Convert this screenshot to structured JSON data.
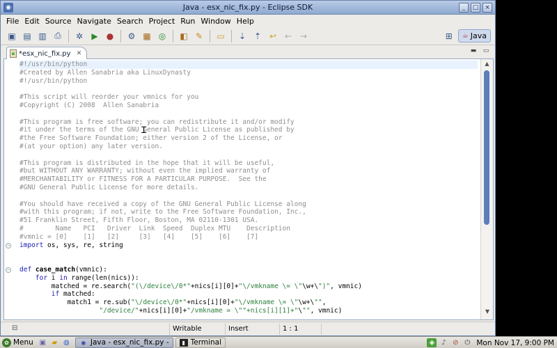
{
  "window": {
    "title": "Java - esx_nic_fix.py - Eclipse SDK"
  },
  "menubar": [
    "File",
    "Edit",
    "Source",
    "Navigate",
    "Search",
    "Project",
    "Run",
    "Window",
    "Help"
  ],
  "toolbar": {
    "icons": [
      "new-icon",
      "save-icon",
      "save-all-icon",
      "print-icon",
      "debug-icon",
      "run-icon",
      "external-tools-icon",
      "new-java-project-icon",
      "new-package-icon",
      "new-class-icon",
      "open-type-icon",
      "search-icon",
      "open-folder-icon",
      "annotation-next-icon",
      "annotation-prev-icon",
      "last-edit-icon",
      "back-icon",
      "forward-icon"
    ]
  },
  "perspective": {
    "label": "Java"
  },
  "editor": {
    "tab_label": "*esx_nic_fix.py",
    "lines": [
      {
        "t": "#!/usr/bin/python",
        "c": "cm",
        "current": true
      },
      {
        "t": "#Created by Allen Sanabria aka LinuxDynasty",
        "c": "cm"
      },
      {
        "t": "#!/usr/bin/python",
        "c": "cm"
      },
      {
        "t": "",
        "c": "cm"
      },
      {
        "t": "#This script will reorder your vmnics for you",
        "c": "cm"
      },
      {
        "t": "#Copyright (C) 2008  Allen Sanabria",
        "c": "cm"
      },
      {
        "t": "",
        "c": "cm"
      },
      {
        "t": "#This program is free software; you can redistribute it and/or modify",
        "c": "cm"
      },
      {
        "t": "#it under the terms of the GNU General Public License as published by",
        "c": "cm"
      },
      {
        "t": "#the Free Software Foundation; either version 2 of the License, or",
        "c": "cm"
      },
      {
        "t": "#(at your option) any later version.",
        "c": "cm"
      },
      {
        "t": "",
        "c": "cm"
      },
      {
        "t": "#This program is distributed in the hope that it will be useful,",
        "c": "cm"
      },
      {
        "t": "#but WITHOUT ANY WARRANTY; without even the implied warranty of",
        "c": "cm"
      },
      {
        "t": "#MERCHANTABILITY or FITNESS FOR A PARTICULAR PURPOSE.  See the",
        "c": "cm"
      },
      {
        "t": "#GNU General Public License for more details.",
        "c": "cm"
      },
      {
        "t": "",
        "c": "cm"
      },
      {
        "t": "#You should have received a copy of the GNU General Public License along",
        "c": "cm"
      },
      {
        "t": "#with this program; if not, write to the Free Software Foundation, Inc.,",
        "c": "cm"
      },
      {
        "t": "#51 Franklin Street, Fifth Floor, Boston, MA 02110-1301 USA.",
        "c": "cm"
      },
      {
        "t": "#        Name   PCI   Driver  Link  Speed  Duplex MTU    Description",
        "c": "cm"
      },
      {
        "t": "#vmnic = [0]    [1]   [2]     [3]   [4]    [5]    [6]    [7]",
        "c": "cm"
      },
      {
        "t": "import os, sys, re, string",
        "c": "import",
        "fold": true
      },
      {
        "t": "",
        "c": ""
      },
      {
        "t": "",
        "c": ""
      },
      {
        "t": "def case_match(vmnic):",
        "c": "def",
        "fold": true
      },
      {
        "t": "    for i in range(len(nics)):",
        "c": "for"
      },
      {
        "t": "        matched = re.search(\"(\\/device\\/0*\"+nics[i][0]+\"\\/vmkname \\= \\\"\\w+\\\")\", vmnic)",
        "c": "search"
      },
      {
        "t": "        if matched:",
        "c": "if"
      },
      {
        "t": "            match1 = re.sub(\"\\/device\\/0*\"+nics[i][0]+\"\\/vmkname \\= \\\"\\w+\\\"\",",
        "c": "sub"
      },
      {
        "t": "                    \"/device/\"+nics[i][0]+\"/vmkname = \\\"\"+nics[i][1]+\"\\\"\", vmnic)",
        "c": "cut"
      }
    ]
  },
  "status": {
    "writable": "Writable",
    "insert": "Insert",
    "position": "1 : 1"
  },
  "taskbar": {
    "menu_label": "Menu",
    "task_eclipse": "Java - esx_nic_fix.py -",
    "task_terminal": "Terminal",
    "clock": "Mon Nov 17,  9:00 PM"
  }
}
